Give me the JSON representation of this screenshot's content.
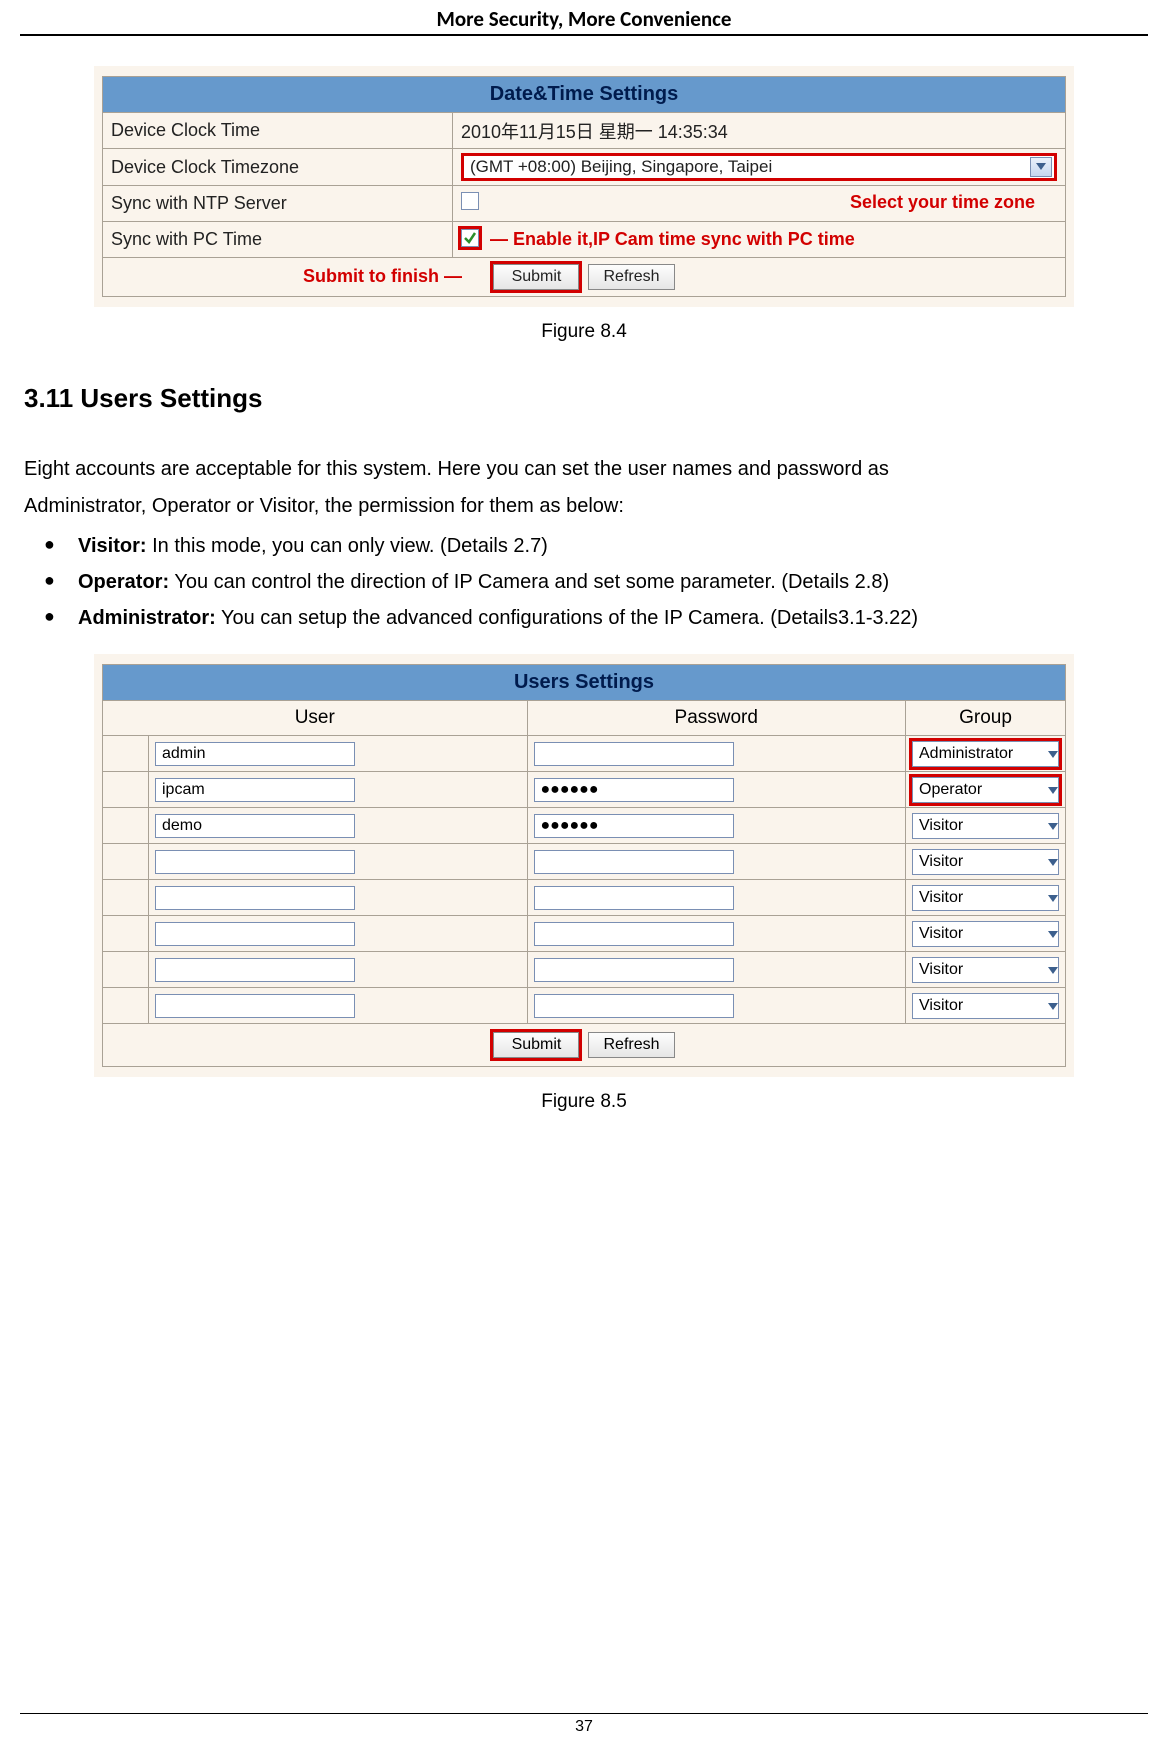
{
  "header": "More Security, More Convenience",
  "page_number": "37",
  "fig84": {
    "title": "Date&Time Settings",
    "rows": {
      "r1_label": "Device Clock Time",
      "r1_value": "2010年11月15日 星期一  14:35:34",
      "r2_label": "Device Clock Timezone",
      "r2_value": "(GMT +08:00) Beijing, Singapore, Taipei",
      "r3_label": "Sync with NTP Server",
      "r4_label": "Sync with PC Time"
    },
    "annot_tz": "Select your time zone",
    "annot_sync": "Enable it,IP Cam time sync with PC time",
    "annot_submit": "Submit to finish",
    "btn_submit": "Submit",
    "btn_refresh": "Refresh",
    "caption": "Figure 8.4"
  },
  "section": {
    "heading": "3.11 Users Settings",
    "intro1": "Eight accounts are acceptable for this system. Here you can set the user names and password as",
    "intro2": "Administrator, Operator or Visitor, the permission for them as below:",
    "b1_label": "Visitor:",
    "b1_text": " In this mode, you can only view. (Details 2.7)",
    "b2_label": "Operator:",
    "b2_text": " You can control the direction of IP Camera and set some parameter. (Details 2.8)",
    "b3_label": "Administrator:",
    "b3_text": " You can setup the advanced configurations of the IP Camera. (Details3.1-3.22)"
  },
  "fig85": {
    "title": "Users Settings",
    "col_user": "User",
    "col_password": "Password",
    "col_group": "Group",
    "rows": [
      {
        "user": "admin",
        "password": "",
        "group": "Administrator",
        "highlight": true
      },
      {
        "user": "ipcam",
        "password": "●●●●●●",
        "group": "Operator",
        "highlight": true
      },
      {
        "user": "demo",
        "password": "●●●●●●",
        "group": "Visitor",
        "highlight": false
      },
      {
        "user": "",
        "password": "",
        "group": "Visitor",
        "highlight": false
      },
      {
        "user": "",
        "password": "",
        "group": "Visitor",
        "highlight": false
      },
      {
        "user": "",
        "password": "",
        "group": "Visitor",
        "highlight": false
      },
      {
        "user": "",
        "password": "",
        "group": "Visitor",
        "highlight": false
      },
      {
        "user": "",
        "password": "",
        "group": "Visitor",
        "highlight": false
      }
    ],
    "btn_submit": "Submit",
    "btn_refresh": "Refresh",
    "caption": "Figure 8.5"
  }
}
